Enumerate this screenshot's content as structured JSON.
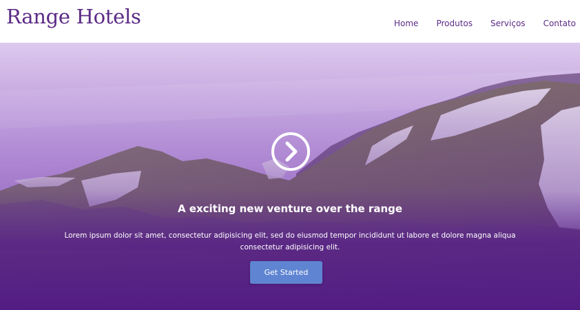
{
  "header": {
    "logo_text": "Range Hotels",
    "nav": [
      {
        "label": "Home"
      },
      {
        "label": "Produtos"
      },
      {
        "label": "Serviços"
      },
      {
        "label": "Contato"
      }
    ]
  },
  "hero": {
    "title": "A exciting new venture over the range",
    "text": "Lorem ipsum dolor sit amet, consectetur adipisicing elit, sed do eiusmod tempor incididunt ut labore et dolore magna aliqua consectetur adipisicing elit.",
    "button_label": "Get Started",
    "arrow_icon": "chevron-right-circle-icon"
  },
  "colors": {
    "brand": "#5b2a86",
    "button": "#5f84d1",
    "overlay": "#5a1f86"
  }
}
